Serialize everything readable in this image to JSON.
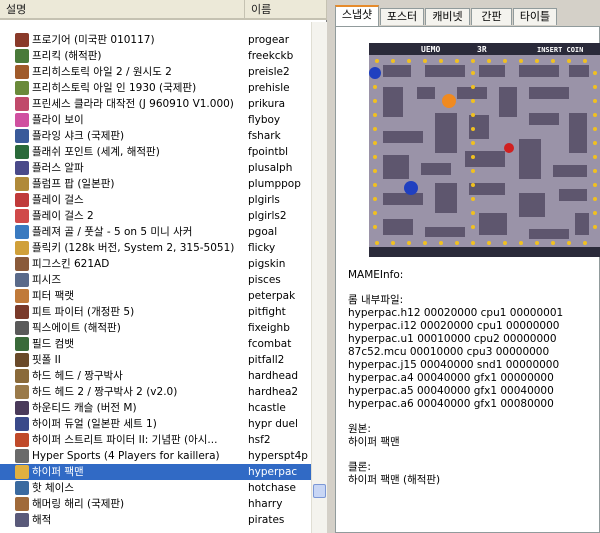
{
  "list": {
    "header": {
      "description": "설명",
      "name": "이름"
    },
    "rows": [
      {
        "desc": "프로기어 (미국판 010117)",
        "name": "progear",
        "color": "#8a3a2a"
      },
      {
        "desc": "프리킥 (해적판)",
        "name": "freekckb",
        "color": "#4a7a3a"
      },
      {
        "desc": "프리히스토릭 아일 2 / 원시도 2",
        "name": "preisle2",
        "color": "#a05a2a"
      },
      {
        "desc": "프리히스토릭 아일 인 1930 (국제판)",
        "name": "prehisle",
        "color": "#6a8a3a"
      },
      {
        "desc": "프린세스 클라라 대작전 (J 960910 V1.000)",
        "name": "prikura",
        "color": "#c04a6a"
      },
      {
        "desc": "플라이 보이",
        "name": "flyboy",
        "color": "#d050a0"
      },
      {
        "desc": "플라잉 샤크 (국제판)",
        "name": "fshark",
        "color": "#3a5a9a"
      },
      {
        "desc": "플래쉬 포인트 (세계, 해적판)",
        "name": "fpointbl",
        "color": "#2a6a3a"
      },
      {
        "desc": "플러스 알파",
        "name": "plusalph",
        "color": "#4a4a8a"
      },
      {
        "desc": "플럼프 팝 (일본판)",
        "name": "plumppop",
        "color": "#b08a3a"
      },
      {
        "desc": "플레이 걸스",
        "name": "plgirls",
        "color": "#c03a3a"
      },
      {
        "desc": "플레이 걸스 2",
        "name": "plgirls2",
        "color": "#d04a4a"
      },
      {
        "desc": "플레져 골 / 풋살 - 5 on 5 미니 사커",
        "name": "pgoal",
        "color": "#3a7ac0"
      },
      {
        "desc": "플릭키 (128k 버전, System 2, 315-5051)",
        "name": "flicky",
        "color": "#d0a03a"
      },
      {
        "desc": "피그스킨 621AD",
        "name": "pigskin",
        "color": "#8a5a3a"
      },
      {
        "desc": "피시즈",
        "name": "pisces",
        "color": "#5a6a8a"
      },
      {
        "desc": "피터 팩랫",
        "name": "peterpak",
        "color": "#c07a3a"
      },
      {
        "desc": "피트 파이터 (개정판 5)",
        "name": "pitfight",
        "color": "#7a3a2a"
      },
      {
        "desc": "픽스에이트 (해적판)",
        "name": "fixeighb",
        "color": "#5a5a5a"
      },
      {
        "desc": "필드 컴뱃",
        "name": "fcombat",
        "color": "#3a6a3a"
      },
      {
        "desc": "핏폴 II",
        "name": "pitfall2",
        "color": "#6a4a2a"
      },
      {
        "desc": "하드 헤드 / 짱구박사",
        "name": "hardhead",
        "color": "#8a6a3a"
      },
      {
        "desc": "하드 헤드 2 / 짱구박사 2 (v2.0)",
        "name": "hardhea2",
        "color": "#9a7a4a"
      },
      {
        "desc": "하운티드 캐슬 (버전 M)",
        "name": "hcastle",
        "color": "#4a3a5a"
      },
      {
        "desc": "하이퍼 듀얼 (일본판 세트 1)",
        "name": "hypr duel",
        "color": "#3a4a8a"
      },
      {
        "desc": "하이퍼 스트리트 파이터 II: 기념판 (아시...",
        "name": "hsf2",
        "color": "#c04a2a"
      },
      {
        "desc": "Hyper Sports (4 Players for kaillera)",
        "name": "hyperspt4p",
        "color": "#6a6a6a"
      },
      {
        "desc": "하이퍼 팩맨",
        "name": "hyperpac",
        "color": "#e0b040",
        "selected": true
      },
      {
        "desc": "핫 체이스",
        "name": "hotchase",
        "color": "#3a6aa0"
      },
      {
        "desc": "해머링 해리 (국제판)",
        "name": "hharry",
        "color": "#a06a3a"
      },
      {
        "desc": "해적",
        "name": "pirates",
        "color": "#5a5a7a"
      }
    ]
  },
  "tabs": [
    "스냅샷",
    "포스터",
    "캐비넷",
    "간판",
    "타이틀"
  ],
  "snapshot": {
    "hud_left": "UEMO",
    "hud_mid": "3R",
    "hud_right": "INSERT COIN"
  },
  "info": {
    "mameinfo_label": "MAMEInfo:",
    "files_label": "롬 내부파일:",
    "files": [
      "hyperpac.h12 00020000 cpu1 00000001",
      "hyperpac.i12 00020000 cpu1 00000000",
      "hyperpac.u1 00010000 cpu2 00000000",
      "87c52.mcu 00010000 cpu3 00000000",
      "hyperpac.j15 00040000 snd1 00000000",
      "hyperpac.a4 00040000 gfx1 00000000",
      "hyperpac.a5 00040000 gfx1 00040000",
      "hyperpac.a6 00040000 gfx1 00080000"
    ],
    "original_label": "원본:",
    "original_value": "하이퍼 팩맨",
    "clone_label": "클론:",
    "clone_value": "하이퍼 팩맨 (해적판)"
  }
}
